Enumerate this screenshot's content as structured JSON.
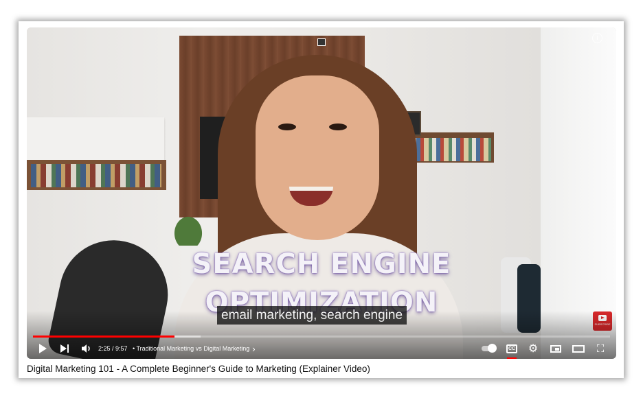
{
  "video": {
    "title": "Digital Marketing 101 - A Complete Beginner's Guide to Marketing (Explainer Video)",
    "overlay_line1": "SEARCH ENGINE",
    "overlay_line2": "OPTIMIZATION",
    "caption": "email marketing, search engine",
    "info_icon": "i"
  },
  "controls": {
    "time": "2:25 / 9:57",
    "chapter": "• Traditional Marketing vs Digital Marketing",
    "chapter_chevron": "›",
    "settings_glyph": "⚙",
    "fullscreen_glyph": "⛶",
    "cc_label": "CC",
    "subscribe_label": "SUBSCRIBE",
    "played_fraction": 0.245,
    "buffered_fraction": 0.29,
    "autoplay_on": true,
    "captions_on": true
  },
  "icons": {
    "play": "play-icon",
    "next": "next-icon",
    "volume": "volume-icon",
    "autoplay": "autoplay-toggle-icon",
    "cc": "captions-icon",
    "settings": "gear-icon",
    "miniplayer": "miniplayer-icon",
    "theater": "theater-mode-icon",
    "fullscreen": "fullscreen-icon"
  },
  "colors": {
    "progress_played": "#ff0000",
    "subscribe": "#d8282a"
  }
}
